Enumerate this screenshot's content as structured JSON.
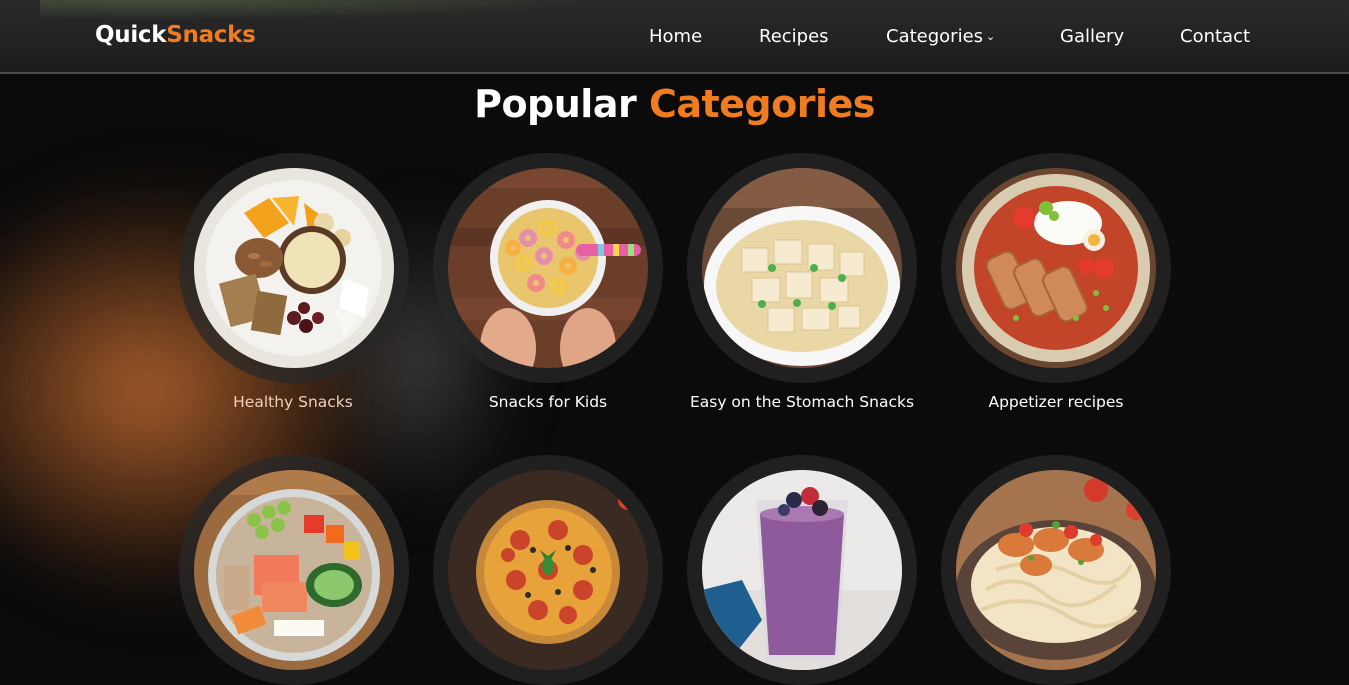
{
  "brand": {
    "part1": "Quick",
    "part2": "Snacks"
  },
  "nav": {
    "home": "Home",
    "recipes": "Recipes",
    "categories": "Categories",
    "gallery": "Gallery",
    "contact": "Contact"
  },
  "section": {
    "title_white": "Popular",
    "title_orange": "Categories"
  },
  "categories": [
    {
      "label": "Healthy Snacks",
      "image": "healthy-snacks-platter"
    },
    {
      "label": "Snacks for Kids",
      "image": "cereal-bowl"
    },
    {
      "label": "Easy on the Stomach Snacks",
      "image": "tofu-bowl"
    },
    {
      "label": "Appetizer recipes",
      "image": "katsu-curry-plate"
    },
    {
      "label": "",
      "image": "poke-bowl"
    },
    {
      "label": "",
      "image": "pizza"
    },
    {
      "label": "",
      "image": "berry-smoothie"
    },
    {
      "label": "",
      "image": "chicken-pasta"
    }
  ],
  "colors": {
    "accent": "#f07c21",
    "background": "#0b0b0b",
    "nav": "#232323"
  }
}
